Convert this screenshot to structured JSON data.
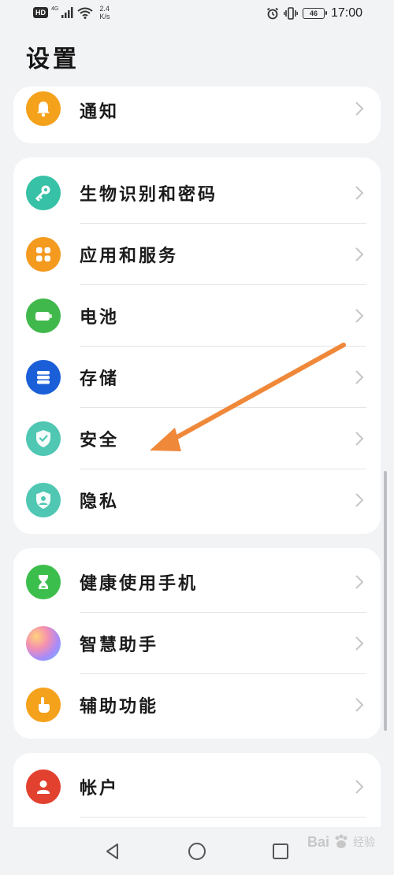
{
  "status_bar": {
    "hd": "HD",
    "network": "4G",
    "speed_value": "2.4",
    "speed_unit": "K/s",
    "battery": "46",
    "time": "17:00"
  },
  "page": {
    "title": "设置"
  },
  "groups": [
    {
      "items": [
        {
          "label": "通知",
          "icon": "bell-icon",
          "color": "#f4a11c"
        }
      ]
    },
    {
      "items": [
        {
          "label": "生物识别和密码",
          "icon": "key-icon",
          "color": "#37c1a6"
        },
        {
          "label": "应用和服务",
          "icon": "apps-grid-icon",
          "color": "#f49a1f"
        },
        {
          "label": "电池",
          "icon": "battery-icon",
          "color": "#41b84c"
        },
        {
          "label": "存储",
          "icon": "storage-icon",
          "color": "#1b5fd8"
        },
        {
          "label": "安全",
          "icon": "shield-check-icon",
          "color": "#4fc7b3"
        },
        {
          "label": "隐私",
          "icon": "privacy-shield-icon",
          "color": "#4fc7b3"
        }
      ]
    },
    {
      "items": [
        {
          "label": "健康使用手机",
          "icon": "hourglass-icon",
          "color": "#3cbe4c"
        },
        {
          "label": "智慧助手",
          "icon": "assistant-orb-icon",
          "color": "#b58cf0"
        },
        {
          "label": "辅助功能",
          "icon": "hand-pointer-icon",
          "color": "#f4a11c"
        }
      ]
    },
    {
      "items": [
        {
          "label": "帐户",
          "icon": "user-icon",
          "color": "#e2412f"
        }
      ]
    }
  ],
  "annotation": {
    "arrow_color": "#f0883a"
  },
  "watermark": {
    "brand": "Bai",
    "brand_suffix": "经验"
  }
}
